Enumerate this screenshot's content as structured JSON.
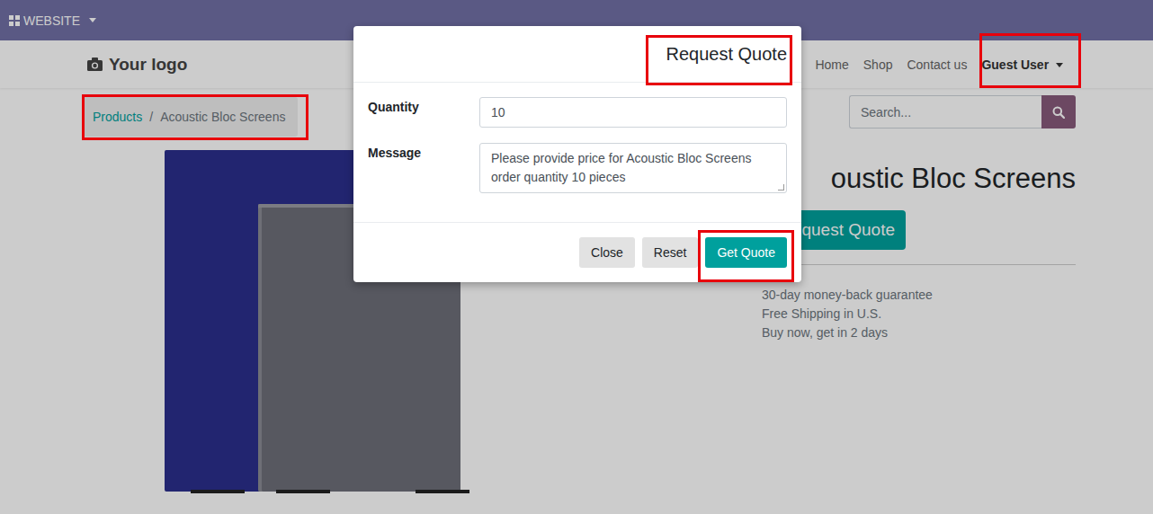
{
  "topbar": {
    "menu": "WEBSITE"
  },
  "header": {
    "logo": "Your logo",
    "nav": [
      "Home",
      "Shop",
      "Contact us"
    ],
    "user_menu": "Guest User"
  },
  "breadcrumb": {
    "items": [
      "Products",
      "Acoustic Bloc Screens"
    ],
    "separator": "/"
  },
  "search": {
    "placeholder": "Search..."
  },
  "product": {
    "title": "oustic Bloc Screens",
    "button": "quest Quote",
    "benefits": [
      "30-day money-back guarantee",
      "Free Shipping in U.S.",
      "Buy now, get in 2 days"
    ]
  },
  "dialog": {
    "title": "Request Quote",
    "fields": [
      {
        "label": "Quantity",
        "kind": "input",
        "value": "10"
      },
      {
        "label": "Message",
        "kind": "textarea",
        "value": "Please provide price for Acoustic Bloc Screens order quantity 10 pieces"
      }
    ],
    "buttons": [
      {
        "label": "Close",
        "primary": false
      },
      {
        "label": "Reset",
        "primary": false
      },
      {
        "label": "Get Quote",
        "primary": true
      }
    ]
  }
}
